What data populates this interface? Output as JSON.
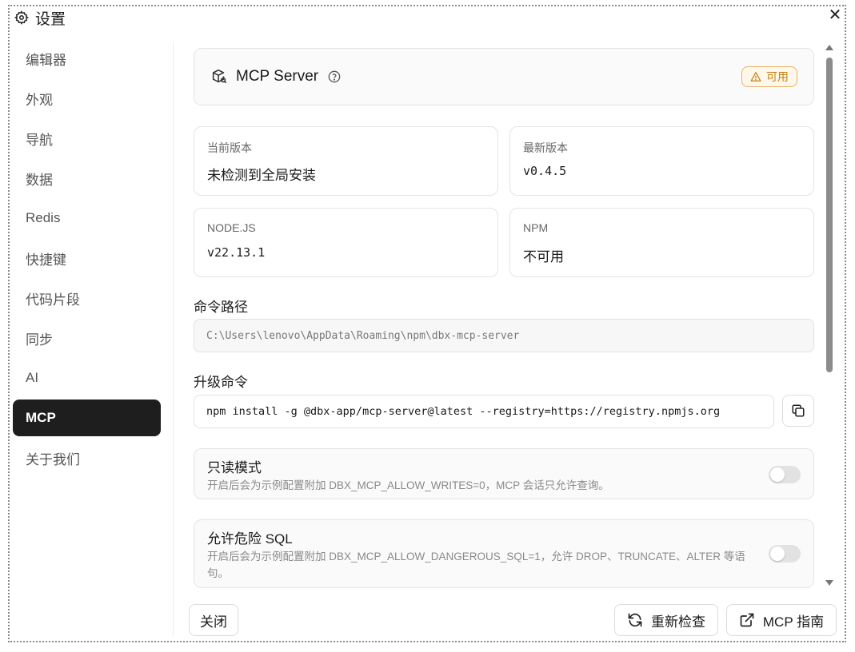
{
  "window": {
    "title": "设置",
    "icon": "gear-icon",
    "close_label": "✕"
  },
  "sidebar": {
    "items": [
      {
        "label": "编辑器",
        "active": false
      },
      {
        "label": "外观",
        "active": false
      },
      {
        "label": "导航",
        "active": false
      },
      {
        "label": "数据",
        "active": false
      },
      {
        "label": "Redis",
        "active": false
      },
      {
        "label": "快捷键",
        "active": false
      },
      {
        "label": "代码片段",
        "active": false
      },
      {
        "label": "同步",
        "active": false
      },
      {
        "label": "AI",
        "active": false
      },
      {
        "label": "MCP",
        "active": true
      },
      {
        "label": "关于我们",
        "active": false
      }
    ]
  },
  "header": {
    "title": "MCP Server",
    "icon": "package-search-icon",
    "help_icon": "help-circle-icon",
    "status": {
      "label": "可用",
      "icon": "warning-triangle-icon",
      "color": "#c87d14"
    }
  },
  "info": {
    "current_version": {
      "label": "当前版本",
      "value": "未检测到全局安装"
    },
    "latest_version": {
      "label": "最新版本",
      "value": "v0.4.5"
    },
    "nodejs": {
      "label": "NODE.JS",
      "value": "v22.13.1"
    },
    "npm": {
      "label": "NPM",
      "value": "不可用"
    }
  },
  "command_path": {
    "label": "命令路径",
    "value": "C:\\Users\\lenovo\\AppData\\Roaming\\npm\\dbx-mcp-server"
  },
  "upgrade": {
    "label": "升级命令",
    "value": "npm install -g @dbx-app/mcp-server@latest --registry=https://registry.npmjs.org",
    "copy_icon": "copy-icon"
  },
  "toggles": [
    {
      "title": "只读模式",
      "description": "开启后会为示例配置附加 DBX_MCP_ALLOW_WRITES=0，MCP 会话只允许查询。",
      "enabled": false
    },
    {
      "title": "允许危险 SQL",
      "description": "开启后会为示例配置附加 DBX_MCP_ALLOW_DANGEROUS_SQL=1，允许 DROP、TRUNCATE、ALTER 等语句。",
      "enabled": false
    }
  ],
  "footer": {
    "close_label": "关闭",
    "recheck_label": "重新检查",
    "recheck_icon": "refresh-icon",
    "guide_label": "MCP 指南",
    "guide_icon": "external-link-icon"
  }
}
